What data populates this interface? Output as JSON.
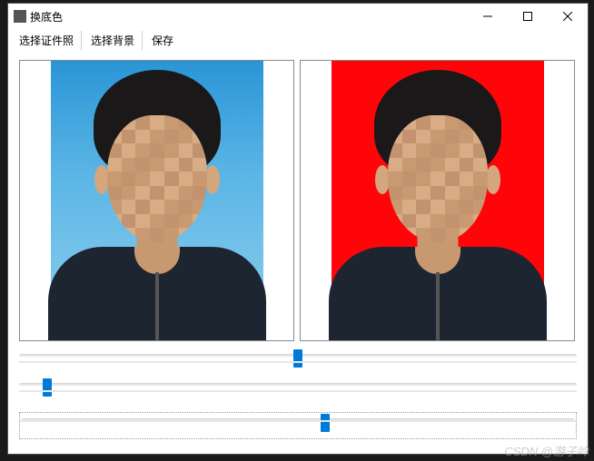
{
  "window": {
    "title": "换底色"
  },
  "menu": {
    "select_photo": "选择证件照",
    "select_background": "选择背景",
    "save": "保存"
  },
  "photos": {
    "left_bg_color": "#3aa0db",
    "right_bg_color": "#ff0509"
  },
  "sliders": {
    "slider1": {
      "value": 50,
      "min": 0,
      "max": 100
    },
    "slider2": {
      "value": 5,
      "min": 0,
      "max": 100
    },
    "slider3": {
      "value": 55,
      "min": 0,
      "max": 100
    }
  },
  "watermark": "CSDN @游子吟"
}
